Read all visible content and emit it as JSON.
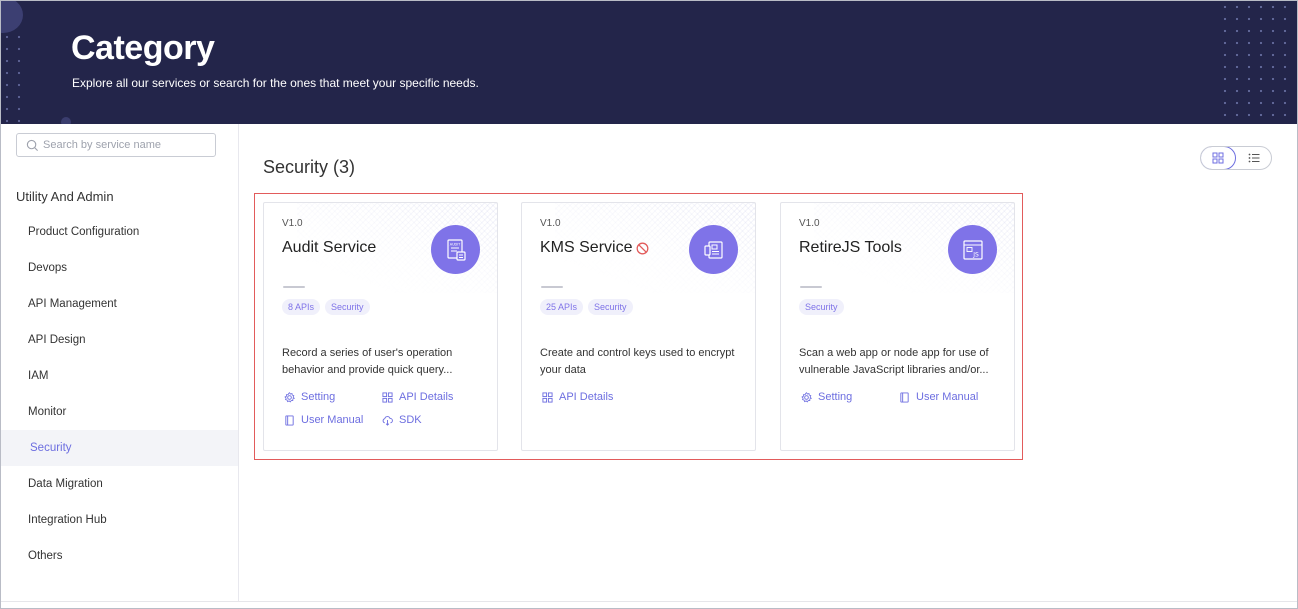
{
  "header": {
    "title": "Category",
    "subtitle": "Explore all our services or search for the ones that meet your specific needs."
  },
  "sidebar": {
    "search_placeholder": "Search by service name",
    "group_title": "Utility And Admin",
    "items": [
      {
        "label": "Product Configuration",
        "active": false
      },
      {
        "label": "Devops",
        "active": false
      },
      {
        "label": "API Management",
        "active": false
      },
      {
        "label": "API Design",
        "active": false
      },
      {
        "label": "IAM",
        "active": false
      },
      {
        "label": "Monitor",
        "active": false
      },
      {
        "label": "Security",
        "active": true
      },
      {
        "label": "Data Migration",
        "active": false
      },
      {
        "label": "Integration Hub",
        "active": false
      },
      {
        "label": "Others",
        "active": false
      }
    ]
  },
  "main": {
    "section_title": "Security (3)",
    "view_mode": "grid",
    "cards": [
      {
        "version": "V1.0",
        "name": "Audit Service",
        "icon": "audit-document-icon",
        "tags": [
          "8 APIs",
          "Security"
        ],
        "description": "Record a series of user's operation behavior and provide quick query...",
        "links": [
          "Setting",
          "API Details",
          "User Manual",
          "SDK"
        ]
      },
      {
        "version": "V1.0",
        "name": "KMS Service",
        "disabled_marker": "prohibited-icon",
        "icon": "key-management-icon",
        "tags": [
          "25 APIs",
          "Security"
        ],
        "description": "Create and control keys used to encrypt your data",
        "links": [
          "API Details"
        ]
      },
      {
        "version": "V1.0",
        "name": "RetireJS Tools",
        "icon": "js-file-icon",
        "tags": [
          "Security"
        ],
        "description": "Scan a web app or node app for use of vulnerable JavaScript libraries and/or...",
        "links": [
          "Setting",
          "User Manual"
        ]
      }
    ]
  },
  "colors": {
    "banner_bg": "#23254a",
    "accent": "#6d6ee0",
    "icon_bg": "#7f73e8",
    "highlight_border": "#e25b5b"
  }
}
